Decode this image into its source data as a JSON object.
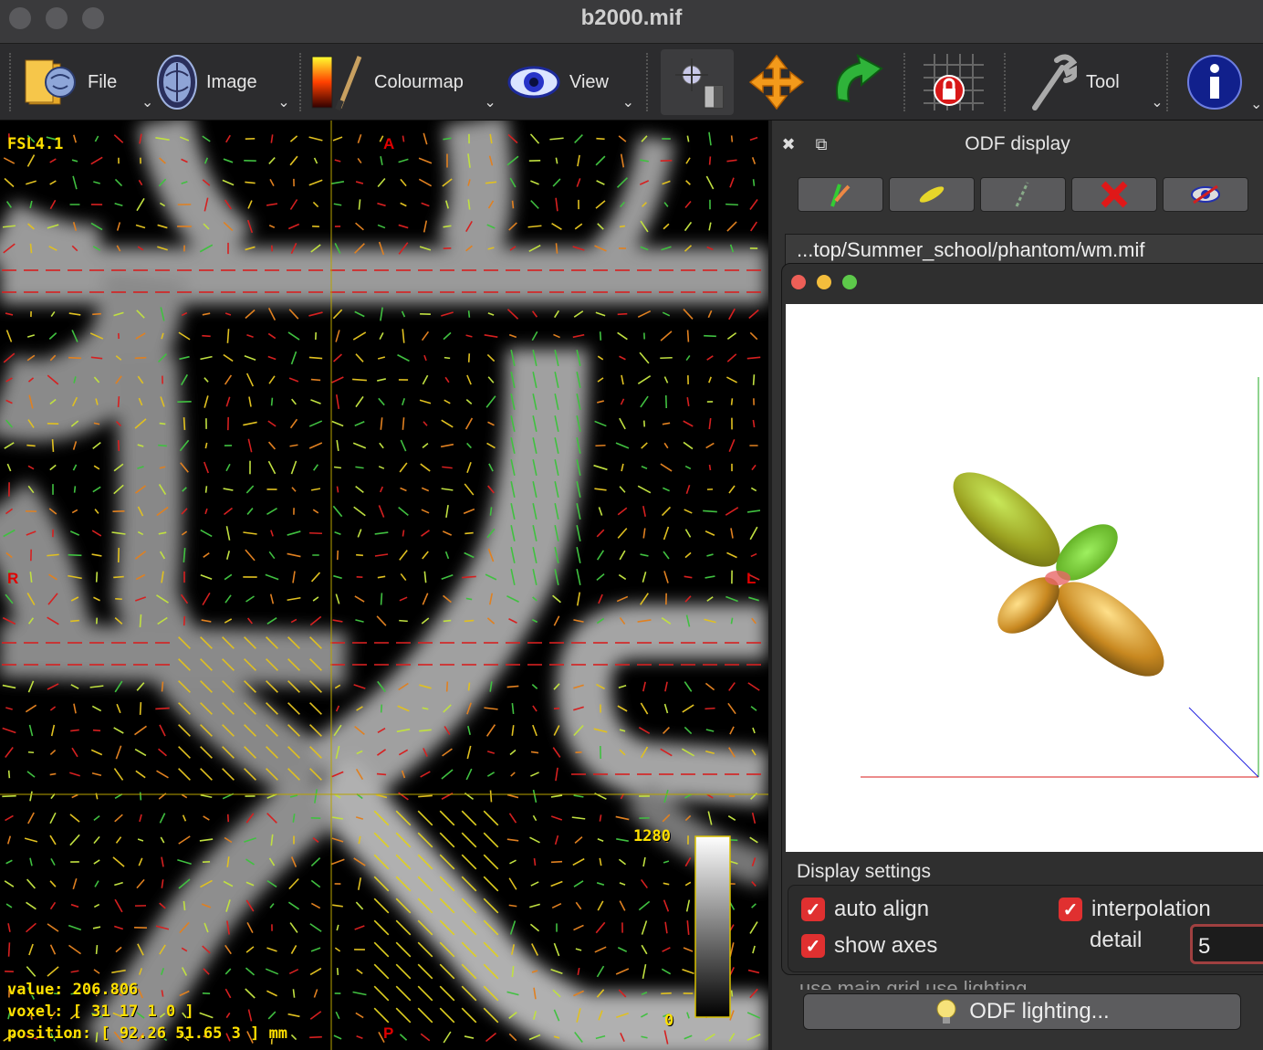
{
  "window": {
    "title": "b2000.mif"
  },
  "toolbar": {
    "file_label": "File",
    "image_label": "Image",
    "colourmap_label": "Colourmap",
    "view_label": "View",
    "tool_label": "Tool",
    "icons": [
      "folder-brain-icon",
      "brain-scan-icon",
      "colourbar-brush-icon",
      "eye-icon",
      "crosshair-mode-icon",
      "move-arrows-icon",
      "rotate-arrow-icon",
      "lock-grid-icon",
      "wrench-icon",
      "info-icon"
    ]
  },
  "viewer": {
    "modality_label": "FSL4.1",
    "orientation": {
      "top": "A",
      "bottom": "P",
      "left": "R",
      "right": "L"
    },
    "colorbar_max": "1280",
    "colorbar_min": "0",
    "value_text": "value: 206.806",
    "voxel_text": "voxel: [ 31 17 1 0 ]",
    "position_text": "position: [ 92.26 51.65 3 ] mm"
  },
  "odf_panel": {
    "title": "ODF display",
    "file_path": "...top/Summer_school/phantom/wm.mif",
    "button_icons": [
      "open-odf-icon",
      "colour-odf-icon",
      "load-fixels-icon",
      "close-odf-icon",
      "hide-odf-icon"
    ],
    "display_settings_label": "Display settings",
    "auto_align_label": "auto align",
    "show_axes_label": "show axes",
    "interpolation_label": "interpolation",
    "detail_label": "detail",
    "detail_value": "5",
    "hidden_options_text": "use main grid   use lighting",
    "lighting_button_label": "ODF lighting..."
  }
}
